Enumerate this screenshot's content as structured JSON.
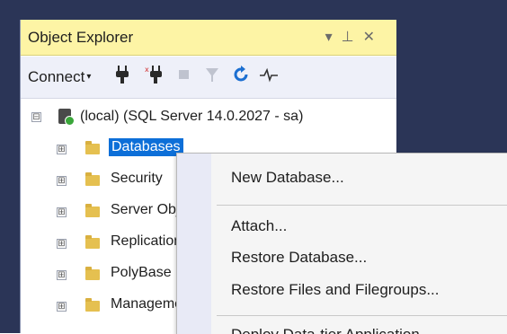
{
  "panel": {
    "title": "Object Explorer",
    "title_controls": [
      "▾",
      "⊥",
      "✕"
    ]
  },
  "toolbar": {
    "connect_label": "Connect",
    "connect_caret": "▾",
    "icons": [
      "connect-plug-icon",
      "disconnect-plug-icon",
      "stop-icon",
      "filter-icon",
      "refresh-icon",
      "activity-monitor-icon"
    ]
  },
  "tree": {
    "server": {
      "expander": "⊟",
      "label": "(local) (SQL Server 14.0.2027 - sa)"
    },
    "nodes": [
      {
        "label": "Databases",
        "expander": "⊞",
        "selected": true
      },
      {
        "label": "Security",
        "expander": "⊞"
      },
      {
        "label": "Server Objects",
        "expander": "⊞"
      },
      {
        "label": "Replication",
        "expander": "⊞"
      },
      {
        "label": "PolyBase",
        "expander": "⊞"
      },
      {
        "label": "Management",
        "expander": "⊞"
      }
    ]
  },
  "context_menu": {
    "items": [
      {
        "label": "New Database..."
      },
      {
        "label": "Attach..."
      },
      {
        "label": "Restore Database..."
      },
      {
        "label": "Restore Files and Filegroups..."
      },
      {
        "label": "Deploy Data-tier Application..."
      }
    ]
  },
  "colors": {
    "title_bar": "#fdf4a5",
    "selection": "#0d6fd8",
    "background_dark": "#2b3557",
    "folder": "#e5c050"
  }
}
